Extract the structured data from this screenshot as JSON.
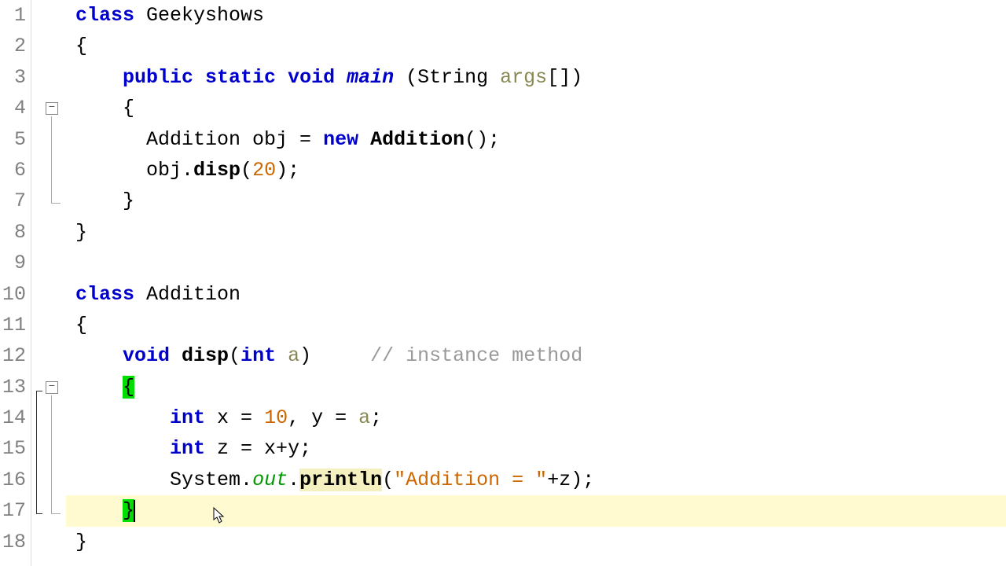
{
  "editor": {
    "line_count": 18,
    "fold_markers": [
      {
        "line": 4,
        "symbol": "−"
      },
      {
        "line": 13,
        "symbol": "−"
      }
    ],
    "lines": {
      "l1": {
        "indent": "",
        "t_class": "class",
        "t_name": " Geekyshows"
      },
      "l2": {
        "text": "{"
      },
      "l3": {
        "indent": "    ",
        "t_public": "public",
        "t_sp1": " ",
        "t_static": "static",
        "t_sp2": " ",
        "t_void": "void",
        "t_sp3": " ",
        "t_main": "main",
        "t_sp4": " ",
        "t_paren": "(String ",
        "t_args": "args",
        "t_arr": "[])"
      },
      "l4": {
        "text": "    {"
      },
      "l5": {
        "indent": "      ",
        "t_addition": "Addition obj = ",
        "t_new": "new",
        "t_sp": " ",
        "t_ctor": "Addition",
        "t_end": "();"
      },
      "l6": {
        "indent": "      ",
        "t_obj": "obj.",
        "t_disp": "disp",
        "t_open": "(",
        "t_num": "20",
        "t_close": ");"
      },
      "l7": {
        "text": "    }"
      },
      "l8": {
        "text": "}"
      },
      "l9": {
        "text": ""
      },
      "l10": {
        "indent": "",
        "t_class": "class",
        "t_name": " Addition"
      },
      "l11": {
        "text": "{"
      },
      "l12": {
        "indent": "    ",
        "t_void": "void",
        "t_sp": " ",
        "t_disp": "disp",
        "t_open": "(",
        "t_int": "int",
        "t_sp2": " ",
        "t_a": "a",
        "t_close": ")",
        "t_pad": "     ",
        "t_comment": "// instance method"
      },
      "l13": {
        "indent": "    ",
        "t_brace": "{"
      },
      "l14": {
        "indent": "        ",
        "t_int": "int",
        "t_mid": " x = ",
        "t_num": "10",
        "t_mid2": ", y = ",
        "t_a": "a",
        "t_semi": ";"
      },
      "l15": {
        "indent": "        ",
        "t_int": "int",
        "t_rest": " z = x+y;"
      },
      "l16": {
        "indent": "        ",
        "t_sys": "System.",
        "t_out": "out",
        "t_dot": ".",
        "t_println": "println",
        "t_open": "(",
        "t_str": "\"Addition = \"",
        "t_end": "+z);"
      },
      "l17": {
        "indent": "    ",
        "t_brace": "}"
      },
      "l18": {
        "text": "}"
      }
    }
  }
}
